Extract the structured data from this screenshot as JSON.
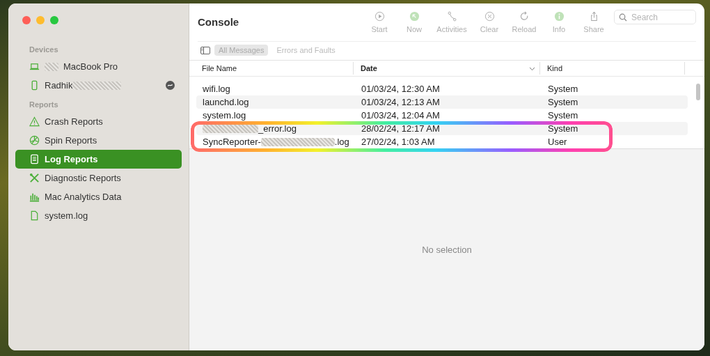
{
  "window": {
    "title": "Console"
  },
  "sidebar": {
    "sections": [
      {
        "heading": "Devices",
        "items": [
          {
            "kind": "laptop",
            "redacted_start": true,
            "label": "MacBook Pro",
            "redacted_end": false,
            "badge": false,
            "selected": false
          },
          {
            "kind": "phone",
            "redacted_start": false,
            "label": "Radhik",
            "redacted_end": true,
            "badge": true,
            "selected": false
          }
        ]
      },
      {
        "heading": "Reports",
        "items": [
          {
            "kind": "warning",
            "redacted_start": false,
            "label": "Crash Reports",
            "redacted_end": false,
            "badge": false,
            "selected": false
          },
          {
            "kind": "spin",
            "redacted_start": false,
            "label": "Spin Reports",
            "redacted_end": false,
            "badge": false,
            "selected": false
          },
          {
            "kind": "doc-lines",
            "redacted_start": false,
            "label": "Log Reports",
            "redacted_end": false,
            "badge": false,
            "selected": true
          },
          {
            "kind": "tools",
            "redacted_start": false,
            "label": "Diagnostic Reports",
            "redacted_end": false,
            "badge": false,
            "selected": false
          },
          {
            "kind": "bars",
            "redacted_start": false,
            "label": "Mac Analytics Data",
            "redacted_end": false,
            "badge": false,
            "selected": false
          },
          {
            "kind": "doc",
            "redacted_start": false,
            "label": "system.log",
            "redacted_end": false,
            "badge": false,
            "selected": false
          }
        ]
      }
    ]
  },
  "toolbar": [
    {
      "kind": "play",
      "label": "Start",
      "disabled": true
    },
    {
      "kind": "now",
      "label": "Now",
      "disabled": true
    },
    {
      "kind": "branch",
      "label": "Activities",
      "disabled": true
    },
    {
      "kind": "clear",
      "label": "Clear",
      "disabled": true
    },
    {
      "kind": "reload",
      "label": "Reload",
      "disabled": true
    },
    {
      "kind": "info",
      "label": "Info",
      "disabled": true
    },
    {
      "kind": "share",
      "label": "Share",
      "disabled": true
    }
  ],
  "search": {
    "placeholder": "Search"
  },
  "filters": [
    {
      "label": "All Messages",
      "selected": true
    },
    {
      "label": "Errors and Faults",
      "selected": false
    }
  ],
  "table": {
    "columns": [
      {
        "label": "File Name",
        "sorted": false
      },
      {
        "label": "Date",
        "sorted": true
      },
      {
        "label": "Kind",
        "sorted": false
      }
    ],
    "rows": [
      {
        "name_start": "",
        "redacted": false,
        "name_end": "wifi.log",
        "date": "01/03/24, 12:30 AM",
        "kind": "System"
      },
      {
        "name_start": "",
        "redacted": false,
        "name_end": "launchd.log",
        "date": "01/03/24, 12:13 AM",
        "kind": "System"
      },
      {
        "name_start": "",
        "redacted": false,
        "name_end": "system.log",
        "date": "01/03/24, 12:04 AM",
        "kind": "System"
      },
      {
        "name_start": "",
        "redacted": true,
        "name_end": "_error.log",
        "date": "28/02/24, 12:17 AM",
        "kind": "System"
      },
      {
        "name_start": "SyncReporter-",
        "redacted": true,
        "name_end": ".log",
        "date": "27/02/24, 1:03 AM",
        "kind": "User"
      }
    ]
  },
  "detail": {
    "empty_text": "No selection"
  }
}
